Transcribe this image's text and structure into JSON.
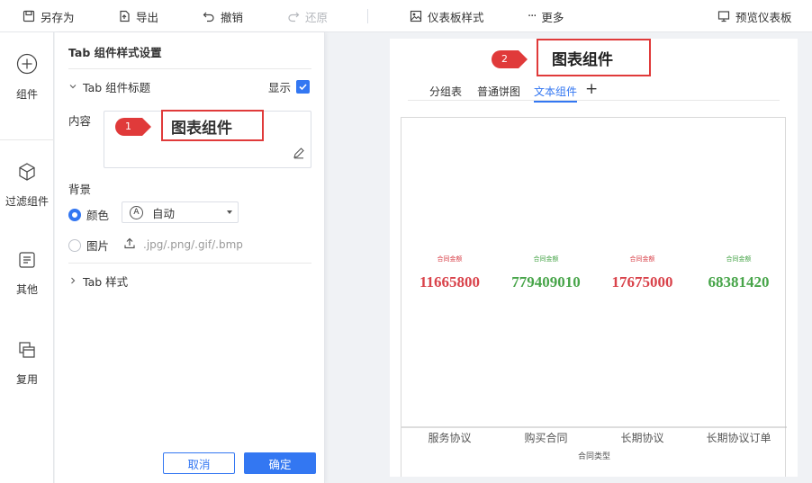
{
  "toolbar": {
    "save_as": "另存为",
    "export": "导出",
    "undo": "撤销",
    "redo": "还原",
    "dashboard_style": "仪表板样式",
    "more": "更多",
    "preview": "预览仪表板"
  },
  "leftnav": {
    "items": [
      {
        "label": "组件",
        "icon": "plus-circle-icon"
      },
      {
        "label": "过滤组件",
        "icon": "cube-icon"
      },
      {
        "label": "其他",
        "icon": "document-icon"
      },
      {
        "label": "复用",
        "icon": "copy-layers-icon"
      }
    ]
  },
  "panel": {
    "title": "Tab 组件样式设置",
    "tab_title_section": "Tab 组件标题",
    "show_label": "显示",
    "show_checked": true,
    "content_label": "内容",
    "content_value": "图表组件",
    "background_label": "背景",
    "color_option": "颜色",
    "color_select_value": "自动",
    "image_option": "图片",
    "image_hint": ".jpg/.png/.gif/.bmp",
    "tab_style_section": "Tab 样式",
    "cancel": "取消",
    "ok": "确定"
  },
  "markers": {
    "one": "1",
    "two": "2"
  },
  "canvas": {
    "title": "图表组件",
    "tabs": [
      "分组表",
      "普通饼图",
      "文本组件"
    ],
    "active_tab": 2,
    "add_tab": "+"
  },
  "chart_data": {
    "type": "table",
    "categories": [
      "服务协议",
      "购买合同",
      "长期协议",
      "长期协议订单"
    ],
    "values": [
      11665800,
      779409010,
      17675000,
      68381420
    ],
    "value_label": "合同金额",
    "xlabel": "合同类型",
    "colors": [
      "#d9434b",
      "#48a54a",
      "#d9434b",
      "#48a54a"
    ]
  }
}
